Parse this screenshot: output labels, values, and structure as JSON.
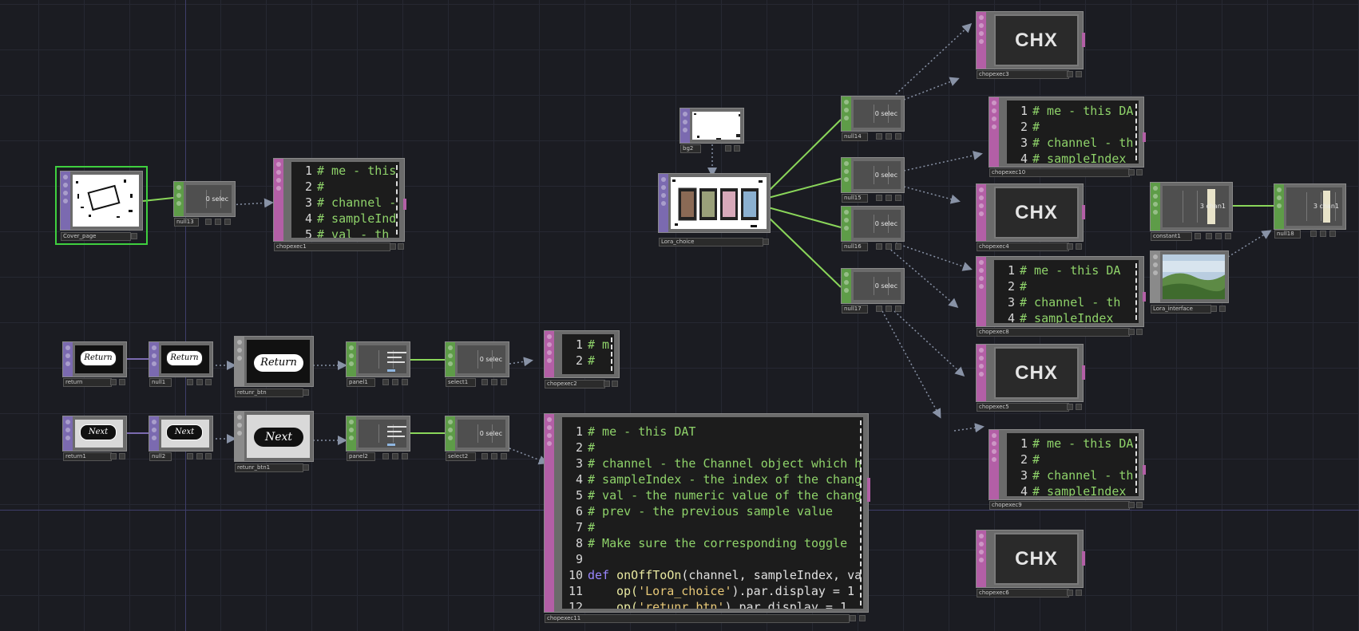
{
  "canvas": {
    "background": "#1b1c22",
    "grid": "#262832",
    "wire_active": "#8ad65a",
    "wire_export": "#8892a6"
  },
  "nodes": {
    "cover_page": {
      "name": "Cover_page"
    },
    "null13": {
      "name": "null13",
      "readout": "0 selec"
    },
    "chopexec1": {
      "name": "chopexec1",
      "lines": [
        "# me - this",
        "#",
        "# channel -",
        "# sampleInd",
        "# val - th"
      ]
    },
    "bg2": {
      "name": "bg2"
    },
    "lora_choice": {
      "name": "Lora_choice"
    },
    "null14": {
      "name": "null14",
      "readout": "0 selec"
    },
    "null15": {
      "name": "null15",
      "readout": "0 selec"
    },
    "null16": {
      "name": "null16",
      "readout": "0 selec"
    },
    "null17": {
      "name": "null17",
      "readout": "0 selec"
    },
    "chopexec3": {
      "name": "chopexec3",
      "label": "CHX"
    },
    "chopexec4": {
      "name": "chopexec4",
      "label": "CHX"
    },
    "chopexec5": {
      "name": "chopexec5",
      "label": "CHX"
    },
    "chopexec6": {
      "name": "chopexec6",
      "label": "CHX"
    },
    "chopexec10": {
      "name": "chopexec10",
      "lines": [
        "# me - this DA",
        "#",
        "# channel - th",
        "# sampleIndex"
      ]
    },
    "chopexec8": {
      "name": "chopexec8",
      "lines": [
        "# me - this DA",
        "#",
        "# channel - th",
        "# sampleIndex"
      ]
    },
    "chopexec9": {
      "name": "chopexec9",
      "lines": [
        "# me - this DA",
        "#",
        "# channel - th",
        "# sampleIndex"
      ]
    },
    "constant1": {
      "name": "constant1",
      "readout": "3 chan1"
    },
    "null18": {
      "name": "null18",
      "readout": "3 chan1"
    },
    "lora_interface": {
      "name": "Lora_interface"
    },
    "return": {
      "name": "return",
      "text": "Return"
    },
    "null1": {
      "name": "null1",
      "text": "Return"
    },
    "retunr_btn": {
      "name": "retunr_btn",
      "text": "Return"
    },
    "panel1": {
      "name": "panel1"
    },
    "select1": {
      "name": "select1",
      "readout": "0 selec"
    },
    "chopexec2": {
      "name": "chopexec2",
      "lines": [
        "# m",
        "#"
      ]
    },
    "return1": {
      "name": "return1",
      "text": "Next"
    },
    "null2": {
      "name": "null2",
      "text": "Next"
    },
    "retunr_btn1": {
      "name": "retunr_btn1",
      "text": "Next"
    },
    "panel2": {
      "name": "panel2"
    },
    "select2": {
      "name": "select2",
      "readout": "0 selec"
    },
    "chopexec11": {
      "name": "chopexec11",
      "line_numbers": [
        "1",
        "2",
        "3",
        "4",
        "5",
        "6",
        "7",
        "8",
        "9",
        "10",
        "11",
        "12"
      ],
      "comments": [
        "# me - this DAT",
        "#",
        "# channel - the Channel object which h",
        "# sampleIndex - the index of the chang",
        "# val - the numeric value of the chang",
        "# prev - the previous sample value",
        "#",
        "# Make sure the corresponding toggle "
      ],
      "def_kw": "def",
      "def_fn": "onOffToOn",
      "def_args": "(channel, sampleIndex, va",
      "call1_fn": "op(",
      "call1_str": "'Lora_choice'",
      "call1_rest": ").par.display = 1",
      "call2_fn": "op(",
      "call2_str": "'retunr_btn'",
      "call2_rest": ").par.display = 1"
    }
  }
}
